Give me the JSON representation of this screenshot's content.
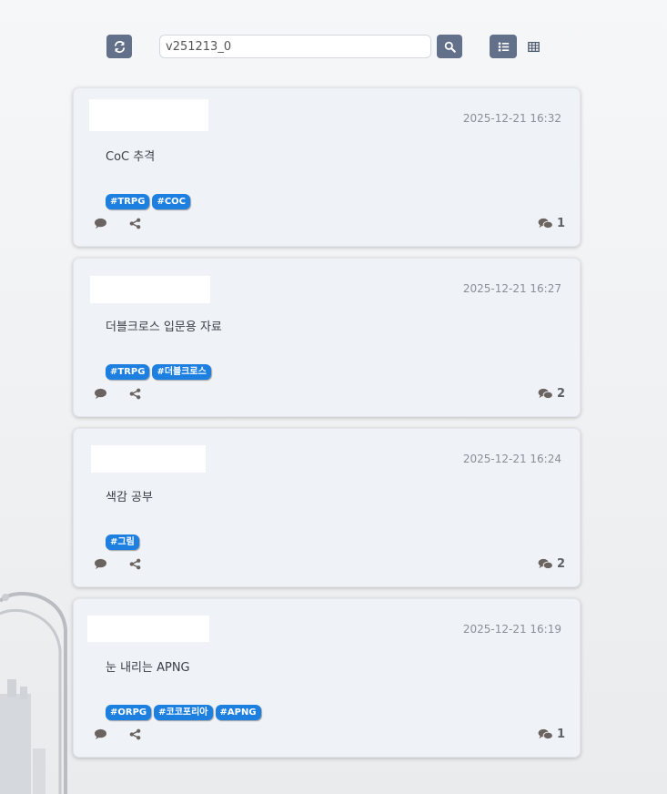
{
  "toolbar": {
    "refresh_icon": "refresh-icon",
    "search_value": "v251213_0",
    "search_icon": "search-icon",
    "list_view_icon": "list-icon",
    "grid_view_icon": "grid-icon"
  },
  "colors": {
    "button": "#627089",
    "card_bg": "#eff2f7",
    "tag": "#1d7fe0",
    "icon": "#6b6360"
  },
  "posts": [
    {
      "date": "2025-12-21 16:32",
      "title": "CoC 추격",
      "tags": [
        "#TRPG",
        "#COC"
      ],
      "comment_count": "1"
    },
    {
      "date": "2025-12-21 16:27",
      "title": "더블크로스 입문용 자료",
      "tags": [
        "#TRPG",
        "#더블크로스"
      ],
      "comment_count": "2"
    },
    {
      "date": "2025-12-21 16:24",
      "title": "색감 공부",
      "tags": [
        "#그림"
      ],
      "comment_count": "2"
    },
    {
      "date": "2025-12-21 16:19",
      "title": "눈 내리는 APNG",
      "tags": [
        "#ORPG",
        "#코코포리아",
        "#APNG"
      ],
      "comment_count": "1"
    }
  ]
}
